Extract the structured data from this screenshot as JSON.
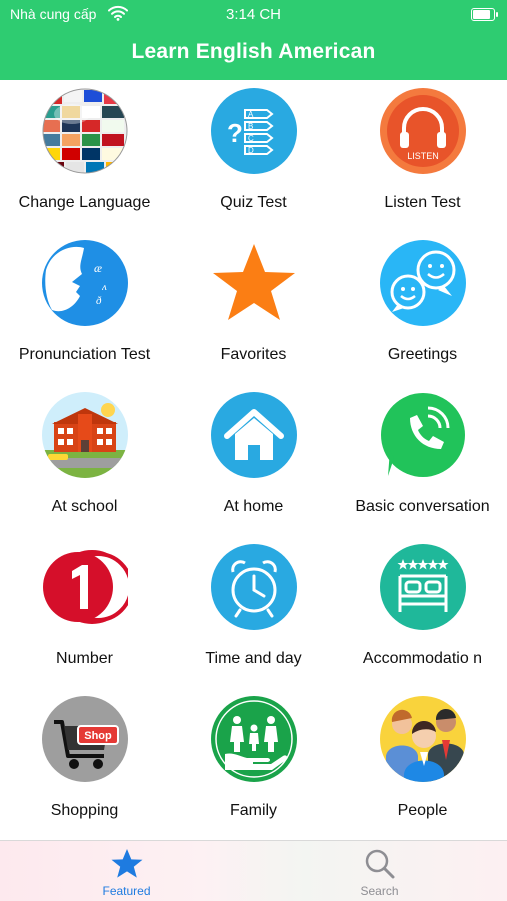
{
  "status_bar": {
    "carrier": "Nhà cung cấp",
    "time": "3:14 CH"
  },
  "nav": {
    "title": "Learn English American"
  },
  "menu": [
    {
      "label": "Change Language",
      "icon": "globe-flags-icon"
    },
    {
      "label": "Quiz Test",
      "icon": "quiz-icon"
    },
    {
      "label": "Listen Test",
      "icon": "headphones-icon",
      "badge": "LISTEN"
    },
    {
      "label": "Pronunciation Test",
      "icon": "speaking-head-icon"
    },
    {
      "label": "Favorites",
      "icon": "star-icon"
    },
    {
      "label": "Greetings",
      "icon": "smiley-chat-icon"
    },
    {
      "label": "At school",
      "icon": "school-building-icon"
    },
    {
      "label": "At home",
      "icon": "house-icon"
    },
    {
      "label": "Basic conversation",
      "icon": "phone-chat-icon"
    },
    {
      "label": "Number",
      "icon": "number-one-icon"
    },
    {
      "label": "Time and day",
      "icon": "alarm-clock-icon"
    },
    {
      "label": "Accommodatio n",
      "icon": "hotel-bed-icon"
    },
    {
      "label": "Shopping",
      "icon": "shopping-cart-icon",
      "badge": "Shop"
    },
    {
      "label": "Family",
      "icon": "family-icon"
    },
    {
      "label": "People",
      "icon": "people-icon"
    }
  ],
  "tabbar": {
    "featured": {
      "label": "Featured",
      "active": true
    },
    "search": {
      "label": "Search",
      "active": false
    }
  },
  "colors": {
    "brand": "#2ecc71",
    "active_tab": "#1e7be0",
    "inactive_tab": "#8e8e93"
  }
}
